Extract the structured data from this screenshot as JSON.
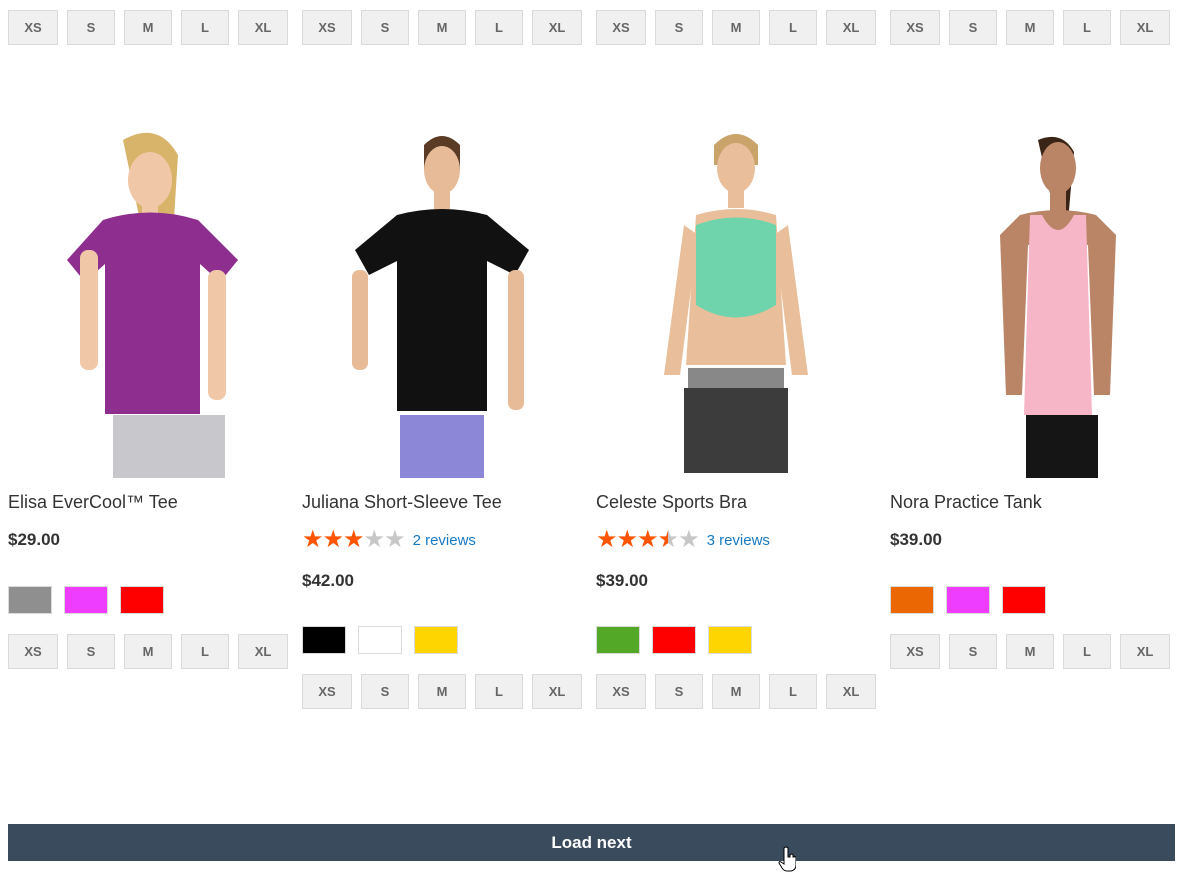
{
  "sizes": [
    "XS",
    "S",
    "M",
    "L",
    "XL"
  ],
  "products": [
    {
      "name": "Elisa EverCool™ Tee",
      "price": "$29.00",
      "rating": null,
      "reviews": null,
      "swatches": [
        "#8f8f8f",
        "#ef3dff",
        "#ff0000"
      ],
      "garment_color": "#8e2f8f",
      "bottom_color": "#c8c8cc"
    },
    {
      "name": "Juliana Short-Sleeve Tee",
      "price": "$42.00",
      "rating": 3,
      "reviews": "2 reviews",
      "swatches": [
        "#000000",
        "#ffffff",
        "#ffd500"
      ],
      "garment_color": "#111111",
      "bottom_color": "#8d87d8"
    },
    {
      "name": "Celeste Sports Bra",
      "price": "$39.00",
      "rating": 3.5,
      "reviews": "3 reviews",
      "swatches": [
        "#53a828",
        "#ff0000",
        "#ffd500"
      ],
      "garment_color": "#6fd3ac",
      "bottom_color": "#3c3c3c"
    },
    {
      "name": "Nora Practice Tank",
      "price": "$39.00",
      "rating": null,
      "reviews": null,
      "swatches": [
        "#eb6703",
        "#ef3dff",
        "#ff0000"
      ],
      "garment_color": "#f6b6c8",
      "bottom_color": "#151515"
    }
  ],
  "load_next_label": "Load next",
  "colors": {
    "accent": "#3a4b5e",
    "star": "#ff5501",
    "link": "#1979c3"
  }
}
